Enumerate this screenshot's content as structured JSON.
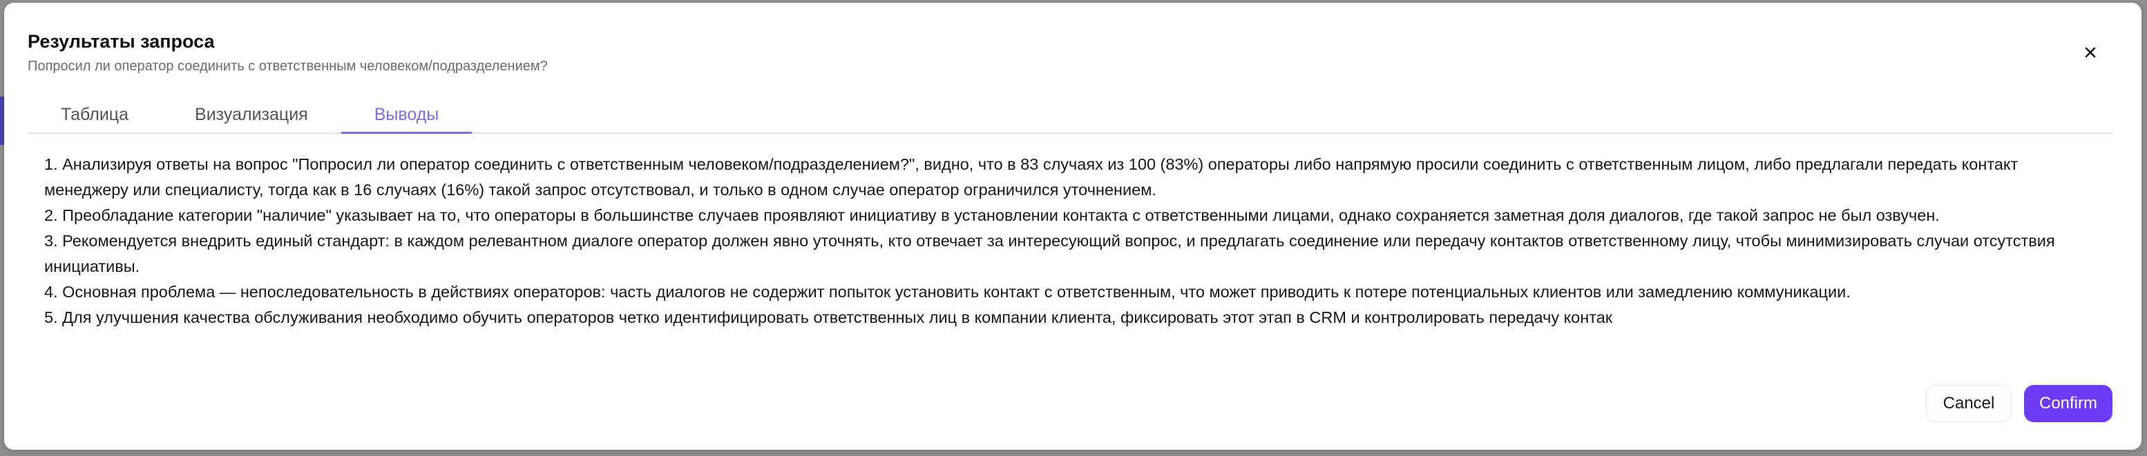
{
  "modal": {
    "title": "Результаты запроса",
    "subtitle": "Попросил ли оператор соединить с ответственным человеком/подразделением?",
    "close_icon": "close-icon"
  },
  "tabs": [
    {
      "label": "Таблица",
      "active": false
    },
    {
      "label": "Визуализация",
      "active": false
    },
    {
      "label": "Выводы",
      "active": true
    }
  ],
  "conclusions": [
    "1. Анализируя ответы на вопрос \"Попросил ли оператор соединить с ответственным человеком/подразделением?\", видно, что в 83 случаях из 100 (83%) операторы либо напрямую просили соединить с ответственным лицом, либо предлагали передать контакт менеджеру или специалисту, тогда как в 16 случаях (16%) такой запрос отсутствовал, и только в одном случае оператор ограничился уточнением.",
    "2. Преобладание категории \"наличие\" указывает на то, что операторы в большинстве случаев проявляют инициативу в установлении контакта с ответственными лицами, однако сохраняется заметная доля диалогов, где такой запрос не был озвучен.",
    "3. Рекомендуется внедрить единый стандарт: в каждом релевантном диалоге оператор должен явно уточнять, кто отвечает за интересующий вопрос, и предлагать соединение или передачу контактов ответственному лицу, чтобы минимизировать случаи отсутствия инициативы.",
    "4. Основная проблема — непоследовательность в действиях операторов: часть диалогов не содержит попыток установить контакт с ответственным, что может приводить к потере потенциальных клиентов или замедлению коммуникации.",
    "5. Для улучшения качества обслуживания необходимо обучить операторов четко идентифицировать ответственных лиц в компании клиента, фиксировать этот этап в CRM и контролировать передачу контак"
  ],
  "footer": {
    "cancel_label": "Cancel",
    "confirm_label": "Confirm"
  },
  "colors": {
    "accent": "#6c3bf3",
    "active_tab": "#7c6cf0"
  }
}
